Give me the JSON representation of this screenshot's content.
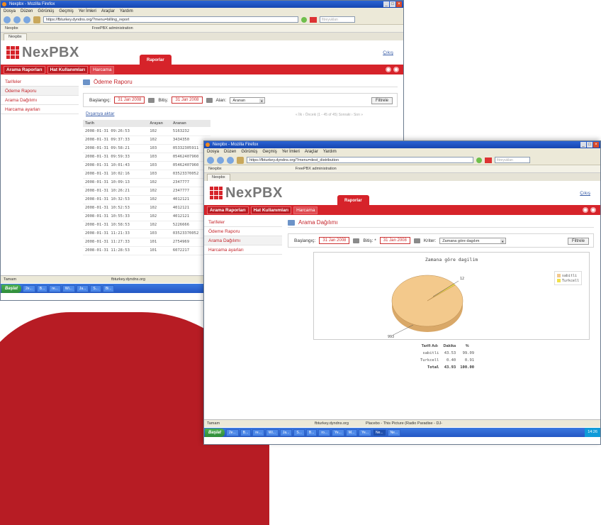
{
  "background": {
    "accent": "#b71c24"
  },
  "window1": {
    "title": "Nexpbx - Mozilla Firefox",
    "menu": [
      "Dosya",
      "Düzen",
      "Görünüş",
      "Geçmiş",
      "Yer İmleri",
      "Araçlar",
      "Yardım"
    ],
    "url": "https://fbturkey.dyndns.org/?menu=billing_report",
    "search_placeholder": "fitreyuklan",
    "bookmarks": [
      "Nexpbx",
      "FreePBX administration"
    ],
    "tab": "Nexpbx",
    "logo": "NexPBX",
    "logout": "Çıkış",
    "raportab": "Raporlar",
    "topnav": [
      "Arama Raporları",
      "Hat Kullanımları",
      "Harcama"
    ],
    "sidebar": [
      "Tarifeler",
      "Ödeme Raporu",
      "Arama Dağılımı",
      "Harcama ayarları"
    ],
    "page_title": "Ödeme Raporu",
    "filter": {
      "start_label": "Başlangıç:",
      "start_value": "31 Jan 2008",
      "end_label": "Bitiş:",
      "end_value": "31 Jan 2008",
      "field_label": "Alan:",
      "field_value": "Aranan",
      "button": "Filtrele"
    },
    "export": "Dışarıya aktar",
    "pager": "« İlk ‹ Önceki (1 - 45 of 45) Sonraki › Son »",
    "table": {
      "headers": [
        "Tarih",
        "Arayan",
        "Aranan"
      ],
      "rows": [
        [
          "2008-01-31 09:26:53",
          "102",
          "5163232"
        ],
        [
          "2008-01-31 09:37:33",
          "102",
          "3434350"
        ],
        [
          "2008-01-31 09:58:21",
          "103",
          "05332305911"
        ],
        [
          "2008-01-31 09:59:33",
          "103",
          "05462407960"
        ],
        [
          "2008-01-31 10:01:43",
          "103",
          "05462407960"
        ],
        [
          "2008-01-31 10:02:16",
          "103",
          "03523370052"
        ],
        [
          "2008-01-31 10:09:13",
          "102",
          "2347777"
        ],
        [
          "2008-01-31 10:26:21",
          "102",
          "2347777"
        ],
        [
          "2008-01-31 10:32:53",
          "102",
          "4012121"
        ],
        [
          "2008-01-31 10:52:53",
          "102",
          "4012121"
        ],
        [
          "2008-01-31 10:55:33",
          "102",
          "4012121"
        ],
        [
          "2008-01-31 10:58:53",
          "102",
          "5226666"
        ],
        [
          "2008-01-31 11:21:33",
          "103",
          "03523370052"
        ],
        [
          "2008-01-31 11:27:33",
          "101",
          "2754969"
        ],
        [
          "2008-01-31 11:28:53",
          "101",
          "6072217"
        ]
      ]
    },
    "status": "Tamam",
    "status_right": "fbturkey.dyndns.org",
    "taskbar": {
      "start": "Başlat",
      "items": [
        "2e...",
        "B...",
        "re...",
        "Wi...",
        "Ja...",
        "S...",
        "Bi..."
      ]
    }
  },
  "window2": {
    "title": "Nexpbx - Mozilla Firefox",
    "menu": [
      "Dosya",
      "Düzen",
      "Görünüş",
      "Geçmiş",
      "Yer İmleri",
      "Araçlar",
      "Yardım"
    ],
    "url": "https://fbturkey.dyndns.org/?menu=dest_distribution",
    "search_placeholder": "fitreyuklan",
    "bookmarks": [
      "Nexpbx",
      "FreePBX administration"
    ],
    "tab": "Nexpbx",
    "logo": "NexPBX",
    "logout": "Çıkış",
    "raportab": "Raporlar",
    "topnav": [
      "Arama Raporları",
      "Hat Kullanımları",
      "Harcama"
    ],
    "sidebar": [
      "Tarifeler",
      "Ödeme Raporu",
      "Arama Dağılımı",
      "Harcama ayarları"
    ],
    "page_title": "Arama Dağılımı",
    "filter": {
      "start_label": "Başlangıç:",
      "start_value": "31 Jan 2008",
      "end_label": "Bitiş: *",
      "end_value": "31 Jan 2008",
      "crit_label": "Kriter:",
      "crit_value": "Zamana göre dagılım",
      "button": "Filtrele"
    },
    "chart_title": "Zamana göre dagilim",
    "legend": [
      "sabitli",
      "Turkcell"
    ],
    "pie_labels": {
      "small": "12",
      "large": "993"
    },
    "summary": {
      "headers": [
        "Tarifi Adı",
        "Dakika",
        "%"
      ],
      "rows": [
        [
          "sabitli",
          "43.53",
          "99.09"
        ],
        [
          "Turkcell",
          "0.40",
          "0.91"
        ]
      ],
      "total": [
        "Total",
        "43.93",
        "100.00"
      ]
    },
    "status": "Tamam",
    "status_right": "fbturkey.dyndns.org",
    "status_media": "Placebo - This Picture (Radio Paradise - DJ-",
    "taskbar": {
      "start": "Başlat",
      "items": [
        "2e...",
        "B...",
        "re...",
        "Wi...",
        "Ja...",
        "S...",
        "B...",
        "ro...",
        "Ye...",
        "M...",
        "Ye...",
        "Ne...",
        "Ne..."
      ],
      "clock": "14:26"
    }
  },
  "chart_data": {
    "type": "pie",
    "title": "Zamana göre dagilim",
    "categories": [
      "sabitli",
      "Turkcell"
    ],
    "values": [
      43.53,
      0.4
    ],
    "percent": [
      99.09,
      0.91
    ],
    "colors": [
      "#f3c98c",
      "#f0e04a"
    ],
    "legend_position": "top-right"
  }
}
